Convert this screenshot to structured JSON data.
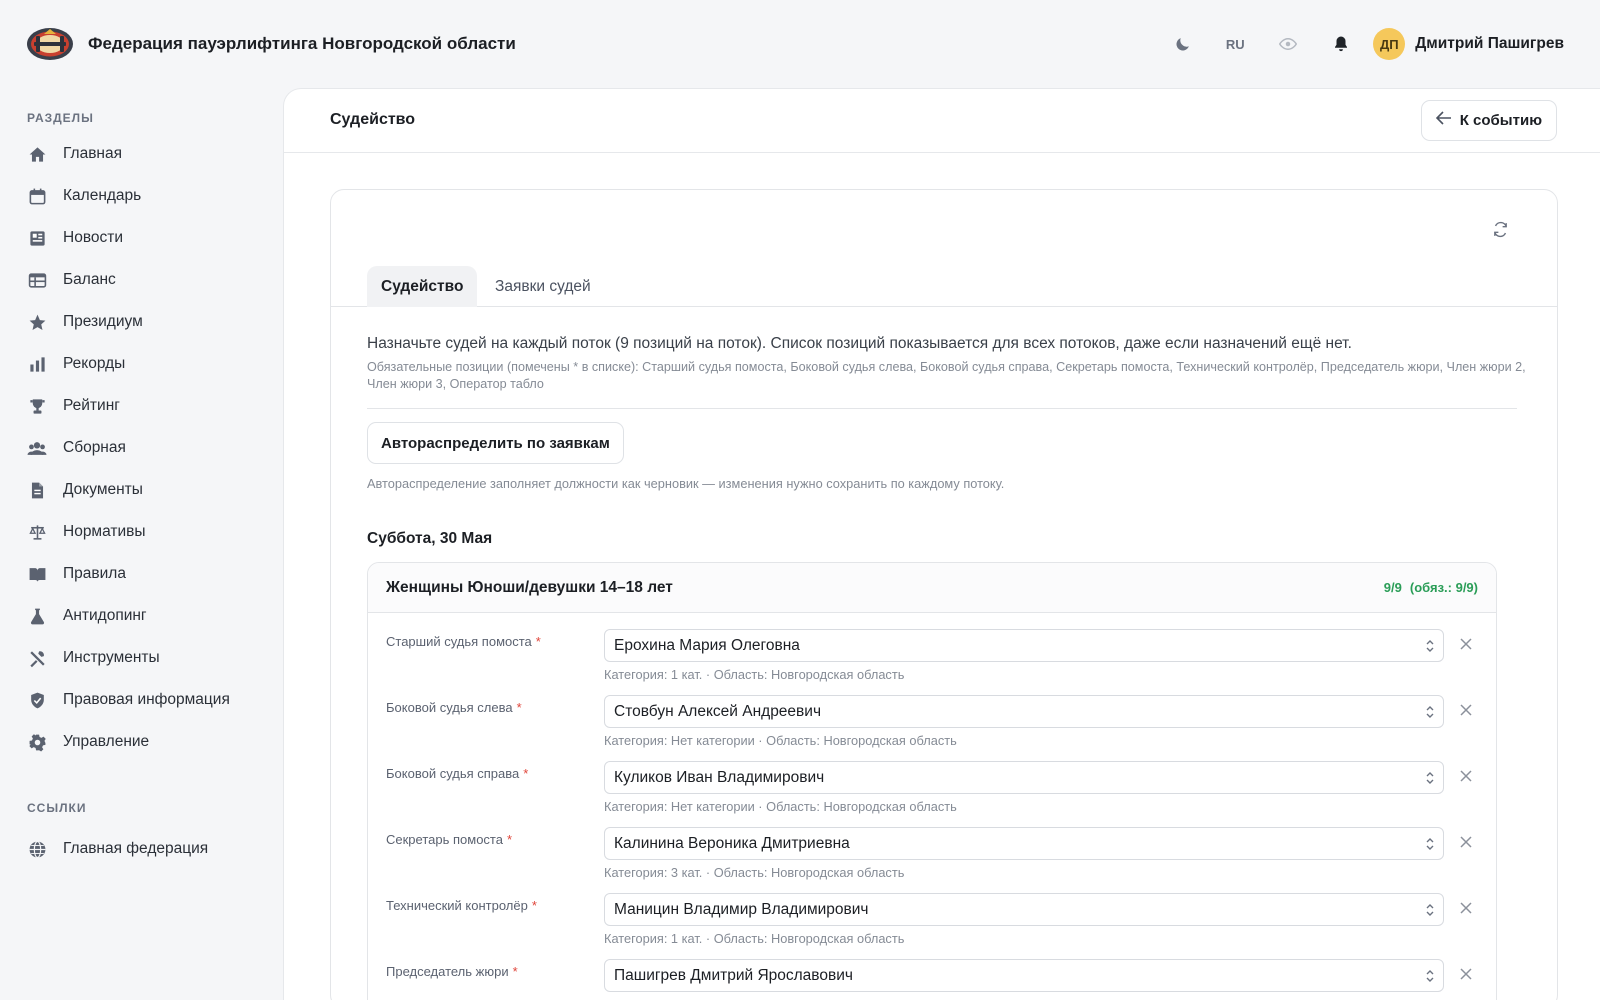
{
  "header": {
    "title": "Федерация пауэрлифтинга Новгородской области",
    "lang": "RU",
    "user": {
      "initials": "ДП",
      "name": "Дмитрий Пашигрев"
    }
  },
  "sidebar": {
    "section_label": "РАЗДЕЛЫ",
    "items": [
      {
        "label": "Главная",
        "icon": "home-icon"
      },
      {
        "label": "Календарь",
        "icon": "calendar-icon"
      },
      {
        "label": "Новости",
        "icon": "newspaper-icon"
      },
      {
        "label": "Баланс",
        "icon": "table-icon"
      },
      {
        "label": "Президиум",
        "icon": "star-icon"
      },
      {
        "label": "Рекорды",
        "icon": "bar-chart-icon"
      },
      {
        "label": "Рейтинг",
        "icon": "trophy-icon"
      },
      {
        "label": "Сборная",
        "icon": "users-icon"
      },
      {
        "label": "Документы",
        "icon": "document-icon"
      },
      {
        "label": "Нормативы",
        "icon": "scales-icon"
      },
      {
        "label": "Правила",
        "icon": "book-icon"
      },
      {
        "label": "Антидопинг",
        "icon": "flask-icon"
      },
      {
        "label": "Инструменты",
        "icon": "tools-icon"
      },
      {
        "label": "Правовая информация",
        "icon": "shield-icon"
      },
      {
        "label": "Управление",
        "icon": "gear-icon"
      }
    ],
    "links_label": "ССЫЛКИ",
    "links": [
      {
        "label": "Главная федерация",
        "icon": "globe-icon"
      }
    ]
  },
  "page": {
    "title": "Судейство",
    "back_button": "К событию"
  },
  "tabs": [
    {
      "label": "Судейство",
      "active": true
    },
    {
      "label": "Заявки судей",
      "active": false
    }
  ],
  "intro": {
    "main": "Назначьте судей на каждый поток (9 позиций на поток). Список позиций показывается для всех потоков, даже если назначений ещё нет.",
    "sub": "Обязательные позиции (помечены * в списке): Старший судья помоста, Боковой судья слева, Боковой судья справа, Секретарь помоста, Технический контролёр, Председатель жюри, Член жюри 2, Член жюри 3, Оператор табло"
  },
  "auto": {
    "button": "Автораспределить по заявкам",
    "note": "Автораспределение заполняет должности как черновик — изменения нужно сохранить по каждому потоку."
  },
  "day_title": "Суббота, 30 Мая",
  "flow": {
    "title": "Женщины Юноши/девушки 14–18 лет",
    "count": "9/9",
    "required_count": "(обяз.: 9/9)",
    "count_color": "#2a9d57",
    "positions": [
      {
        "label": "Старший судья помоста",
        "required": "*",
        "value": "Ерохина Мария Олеговна",
        "meta": "Категория: 1 кат. · Область: Новгородская область"
      },
      {
        "label": "Боковой судья слева",
        "required": "*",
        "value": "Стовбун Алексей Андреевич",
        "meta": "Категория: Нет категории · Область: Новгородская область"
      },
      {
        "label": "Боковой судья справа",
        "required": "*",
        "value": "Куликов Иван Владимирович",
        "meta": "Категория: Нет категории · Область: Новгородская область"
      },
      {
        "label": "Секретарь помоста",
        "required": "*",
        "value": "Калинина Вероника Дмитриевна",
        "meta": "Категория: 3 кат. · Область: Новгородская область"
      },
      {
        "label": "Технический контролёр",
        "required": "*",
        "value": "Маницин Владимир Владимирович",
        "meta": "Категория: 1 кат. · Область: Новгородская область"
      },
      {
        "label": "Председатель жюри",
        "required": "*",
        "value": "Пашигрев Дмитрий Ярославович",
        "meta": ""
      }
    ]
  }
}
